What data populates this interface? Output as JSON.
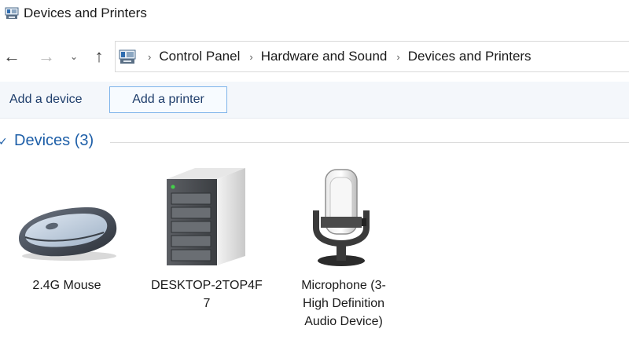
{
  "window": {
    "title": "Devices and Printers",
    "title_icon": "devices-and-printers-icon"
  },
  "navigation": {
    "back_icon": "←",
    "forward_icon": "→",
    "recent_icon": "⌄",
    "up_icon": "↑"
  },
  "address_bar": {
    "icon": "devices-and-printers-icon",
    "separator": "›",
    "crumbs": [
      "Control Panel",
      "Hardware and Sound",
      "Devices and Printers"
    ]
  },
  "command_bar": {
    "add_device": "Add a device",
    "add_printer": "Add a printer"
  },
  "group": {
    "chevron": "✓",
    "title": "Devices (3)"
  },
  "devices": [
    {
      "label": "2.4G Mouse",
      "icon": "mouse-icon"
    },
    {
      "label": "DESKTOP-2TOP4F\n7",
      "icon": "computer-tower-icon"
    },
    {
      "label": "Microphone (3-\nHigh Definition\nAudio Device)",
      "icon": "microphone-icon"
    }
  ],
  "colors": {
    "accent": "#1e5fa8",
    "command_text": "#1e3d6b",
    "command_bar_bg": "#f4f7fb",
    "selected_border": "#7eb4ea"
  }
}
